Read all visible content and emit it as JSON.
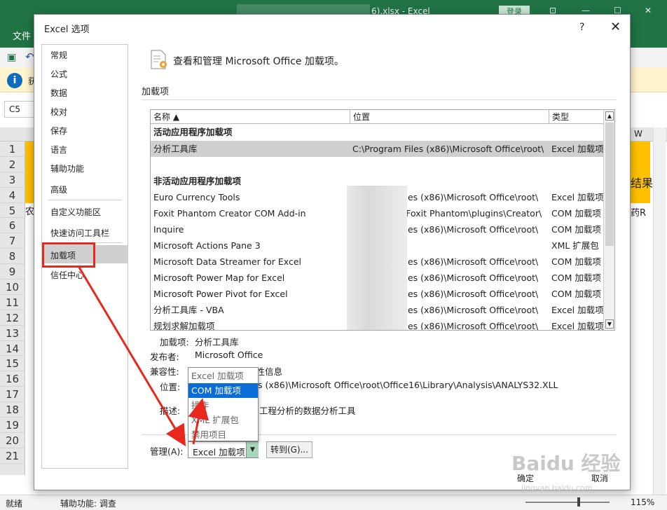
{
  "excel": {
    "window_title": "6).xlsx - Excel",
    "login_label": "登录",
    "file_tab": "文件",
    "info_text": "获",
    "namebox": "C5",
    "col_w": "W",
    "rows": [
      "1",
      "2",
      "3",
      "4",
      "5",
      "6",
      "7",
      "8",
      "9",
      "10",
      "11",
      "12",
      "13",
      "14",
      "15",
      "16",
      "17",
      "18",
      "19",
      "20",
      "21"
    ],
    "cell_left": "农辰",
    "cell_right_label": "结果",
    "cell_right": "药R",
    "status_ready": "就绪",
    "status_accessibility": "辅助功能: 调查",
    "zoom": "115%"
  },
  "dialog": {
    "title": "Excel 选项",
    "help": "?",
    "close": "✕",
    "nav": [
      "常规",
      "公式",
      "数据",
      "校对",
      "保存",
      "语言",
      "辅助功能",
      "高级",
      "自定义功能区",
      "快速访问工具栏",
      "加载项",
      "信任中心"
    ],
    "header_text": "查看和管理 Microsoft Office 加载项。",
    "section_title": "加载项",
    "table": {
      "headers": [
        "名称 ▲",
        "位置",
        "类型"
      ],
      "group_active": "活动应用程序加载项",
      "active_rows": [
        {
          "name": "分析工具库",
          "location": "C:\\Program Files (x86)\\Microsoft Office\\root\\",
          "type": "Excel 加载项"
        }
      ],
      "group_inactive": "非活动应用程序加载项",
      "inactive_rows": [
        {
          "name": "Euro Currency Tools",
          "location": "iles (x86)\\Microsoft Office\\root\\",
          "type": "Excel 加载项"
        },
        {
          "name": "Foxit Phantom Creator COM Add-in",
          "location": "\\Foxit Phantom\\plugins\\Creator\\",
          "type": "COM 加载项"
        },
        {
          "name": "Inquire",
          "location": "iles (x86)\\Microsoft Office\\root\\",
          "type": "COM 加载项"
        },
        {
          "name": "Microsoft Actions Pane 3",
          "location": "",
          "type": "XML 扩展包"
        },
        {
          "name": "Microsoft Data Streamer for Excel",
          "location": "iles (x86)\\Microsoft Office\\root\\",
          "type": "COM 加载项"
        },
        {
          "name": "Microsoft Power Map for Excel",
          "location": "iles (x86)\\Microsoft Office\\root\\",
          "type": "COM 加载项"
        },
        {
          "name": "Microsoft Power Pivot for Excel",
          "location": "iles (x86)\\Microsoft Office\\root\\",
          "type": "COM 加载项"
        },
        {
          "name": "分析工具库 - VBA",
          "location": "iles (x86)\\Microsoft Office\\root\\",
          "type": "Excel 加载项"
        },
        {
          "name": "规划求解加载项",
          "location": "iles (x86)\\Microsoft Office\\root\\",
          "type": "Excel 加载项"
        }
      ]
    },
    "details": {
      "addin_label": "加载项:",
      "addin_value": "分析工具库",
      "publisher_label": "发布者:",
      "publisher_value": "Microsoft Office",
      "compat_label": "兼容性:",
      "compat_value": "没有可用的兼容性信息",
      "location_label": "位置:",
      "location_value": "s (x86)\\Microsoft Office\\root\\Office16\\Library\\Analysis\\ANALYS32.XLL",
      "desc_label": "描述:",
      "desc_value": "工程分析的数据分析工具"
    },
    "manage_label": "管理(A):",
    "manage_value": "Excel 加载项",
    "dropdown_options": [
      "Excel 加载项",
      "COM 加载项",
      "操作",
      "XML 扩展包",
      "禁用项目"
    ],
    "dropdown_selected": 1,
    "goto_button": "转到(G)...",
    "ok_button": "确定",
    "cancel_button": "取消"
  },
  "watermark": {
    "text": "Baidu 经验",
    "sub": "jingyan.baidu.com"
  },
  "colors": {
    "excel_green": "#217346",
    "accent_red": "#e8271d",
    "selection_blue": "#0a6cd6"
  }
}
